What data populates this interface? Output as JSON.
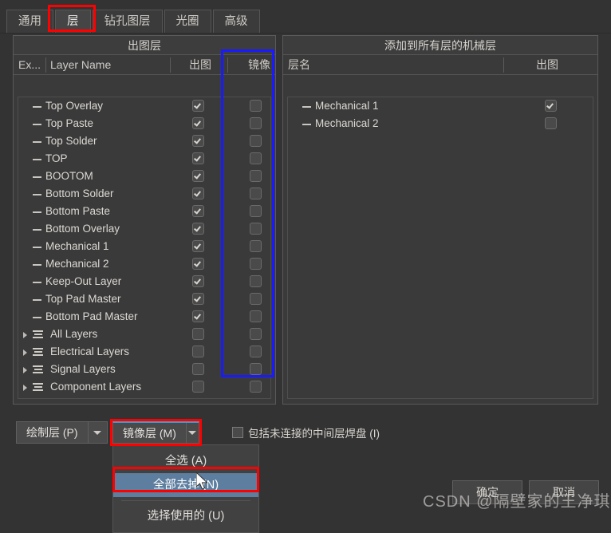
{
  "tabs": [
    {
      "label": "通用"
    },
    {
      "label": "层"
    },
    {
      "label": "钻孔图层"
    },
    {
      "label": "光圈"
    },
    {
      "label": "高级"
    }
  ],
  "left_panel": {
    "title": "出图层",
    "columns": {
      "extend": "Ex...",
      "layer_name": "Layer Name",
      "plot": "出图",
      "mirror": "镜像"
    },
    "rows": [
      {
        "name": "Top Overlay",
        "type": "layer",
        "plot": true,
        "mirror": false
      },
      {
        "name": "Top Paste",
        "type": "layer",
        "plot": true,
        "mirror": false
      },
      {
        "name": "Top Solder",
        "type": "layer",
        "plot": true,
        "mirror": false
      },
      {
        "name": "TOP",
        "type": "layer",
        "plot": true,
        "mirror": false
      },
      {
        "name": "BOOTOM",
        "type": "layer",
        "plot": true,
        "mirror": false
      },
      {
        "name": "Bottom Solder",
        "type": "layer",
        "plot": true,
        "mirror": false
      },
      {
        "name": "Bottom Paste",
        "type": "layer",
        "plot": true,
        "mirror": false
      },
      {
        "name": "Bottom Overlay",
        "type": "layer",
        "plot": true,
        "mirror": false
      },
      {
        "name": "Mechanical 1",
        "type": "layer",
        "plot": true,
        "mirror": false
      },
      {
        "name": "Mechanical 2",
        "type": "layer",
        "plot": true,
        "mirror": false
      },
      {
        "name": "Keep-Out Layer",
        "type": "layer",
        "plot": true,
        "mirror": false
      },
      {
        "name": "Top Pad Master",
        "type": "layer",
        "plot": true,
        "mirror": false
      },
      {
        "name": "Bottom Pad Master",
        "type": "layer",
        "plot": true,
        "mirror": false
      },
      {
        "name": "All Layers",
        "type": "group",
        "plot": false,
        "mirror": false
      },
      {
        "name": "Electrical Layers",
        "type": "group",
        "plot": false,
        "mirror": false
      },
      {
        "name": "Signal Layers",
        "type": "group",
        "plot": false,
        "mirror": false
      },
      {
        "name": "Component Layers",
        "type": "group",
        "plot": false,
        "mirror": false
      }
    ]
  },
  "right_panel": {
    "title": "添加到所有层的机械层",
    "columns": {
      "layer_name": "层名",
      "plot": "出图"
    },
    "rows": [
      {
        "name": "Mechanical 1",
        "type": "layer",
        "plot": true
      },
      {
        "name": "Mechanical 2",
        "type": "layer",
        "plot": false
      }
    ]
  },
  "bottom": {
    "plot_layers_button": "绘制层 (P)",
    "mirror_layers_button": "镜像层 (M)",
    "pad_checkbox_label": "包括未连接的中间层焊盘 (I)",
    "pad_checkbox_checked": false
  },
  "menu": {
    "items": [
      {
        "label": "全选 (A)",
        "selected": false
      },
      {
        "label": "全部去掉 (N)",
        "selected": true
      },
      {
        "label": "选择使用的 (U)",
        "selected": false
      }
    ]
  },
  "dialog": {
    "ok": "确定",
    "cancel": "取消"
  },
  "watermark": "CSDN @隔壁家的王净琪",
  "colors": {
    "panel_bg": "#3a3a3a",
    "window_bg": "#333333",
    "text": "#d6d2cd",
    "menu_highlight": "#5d7e9f",
    "annotation_red": "#ff0000",
    "annotation_blue": "#1a1aff",
    "active_tab_accent": "#4f93c8"
  }
}
